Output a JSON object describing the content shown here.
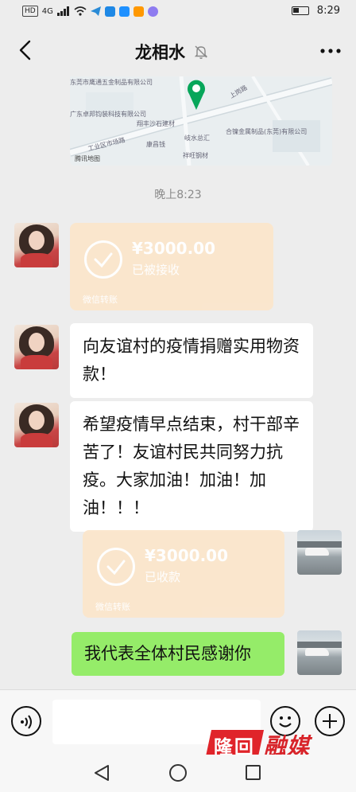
{
  "status_bar": {
    "hd_badge": "HD",
    "network": "4G",
    "time": "8:29"
  },
  "header": {
    "title": "龙相水"
  },
  "map": {
    "labels": [
      "东莞市鹰通五金制品有限公司",
      "广东卓邦钧装科技有限公司",
      "翔丰沙石建材",
      "康昌钱",
      "岐水总汇",
      "合镍金属制品(东莞)有限公司",
      "祥旺钢材",
      "工业区市场路",
      "上岗路",
      "腾讯地图"
    ]
  },
  "chat": {
    "time_label": "晚上8:23",
    "transfer_in": {
      "amount": "¥3000.00",
      "status": "已被接收",
      "foot": "微信转账"
    },
    "msg1": "向友谊村的疫情捐赠实用物资款！",
    "msg2": "希望疫情早点结束，村干部辛苦了！友谊村民共同努力抗疫。大家加油！加油！加油！！！",
    "transfer_out": {
      "amount": "¥3000.00",
      "status": "已收款",
      "foot": "微信转账"
    },
    "reply": "我代表全体村民感谢你"
  },
  "input": {
    "placeholder": ""
  },
  "watermark": {
    "mark": "隆回",
    "text": "融媒"
  },
  "colors": {
    "background": "#ededed",
    "transfer": "#fbe6cc",
    "self_bubble": "#95ec69",
    "map_pin": "#07a65a",
    "watermark": "#e0242a"
  }
}
